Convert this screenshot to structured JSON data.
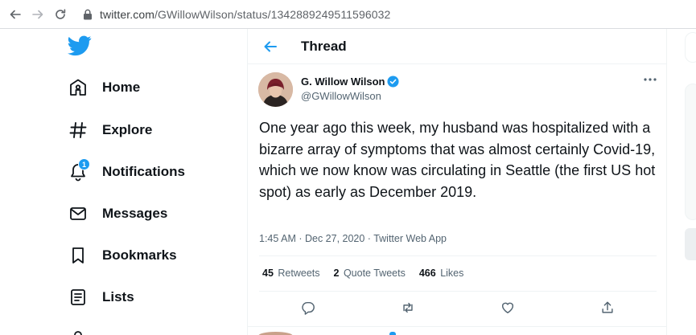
{
  "browser": {
    "url_domain": "twitter.com",
    "url_path": "/GWillowWilson/status/1342889249511596032"
  },
  "sidebar": {
    "items": [
      {
        "label": "Home",
        "icon": "home-icon"
      },
      {
        "label": "Explore",
        "icon": "hashtag-icon"
      },
      {
        "label": "Notifications",
        "icon": "bell-icon",
        "badge": "1"
      },
      {
        "label": "Messages",
        "icon": "envelope-icon"
      },
      {
        "label": "Bookmarks",
        "icon": "bookmark-icon"
      },
      {
        "label": "Lists",
        "icon": "list-icon"
      }
    ]
  },
  "header": {
    "title": "Thread"
  },
  "tweet": {
    "author_name": "G. Willow Wilson",
    "handle": "@GWillowWilson",
    "text": "One year ago this week, my husband was hospitalized with a bizarre array of symptoms that was almost certainly Covid-19, which we now know was circulating in Seattle (the first US hot spot) as early as December 2019.",
    "meta": "1:45 AM · Dec 27, 2020 · Twitter Web App",
    "stats": {
      "retweets_count": "45",
      "retweets_label": "Retweets",
      "quotes_count": "2",
      "quotes_label": "Quote Tweets",
      "likes_count": "466",
      "likes_label": "Likes"
    }
  },
  "colors": {
    "brand": "#1d9bf0",
    "text_primary": "#0f1419",
    "text_secondary": "#536471",
    "border": "#eff3f4"
  }
}
